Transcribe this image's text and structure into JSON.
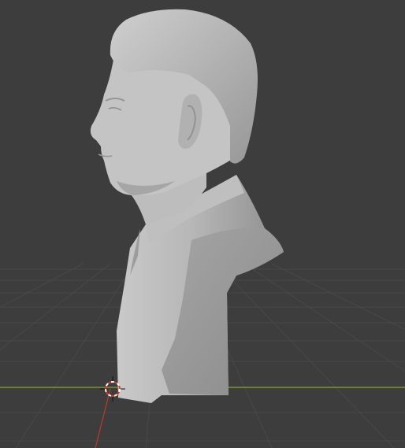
{
  "viewport": {
    "mode": "3d-viewport",
    "shading": "solid",
    "background_color": "#3d3d3d",
    "grid_color": "#484848",
    "x_axis_color": "#8aa43a",
    "y_axis_color": "#c0392b",
    "model_color": "#a9a9a9",
    "object": {
      "name": "",
      "type": "sculpted-bust",
      "icon": "bust-mesh-icon"
    },
    "cursor": {
      "icon": "3d-cursor-icon"
    }
  }
}
